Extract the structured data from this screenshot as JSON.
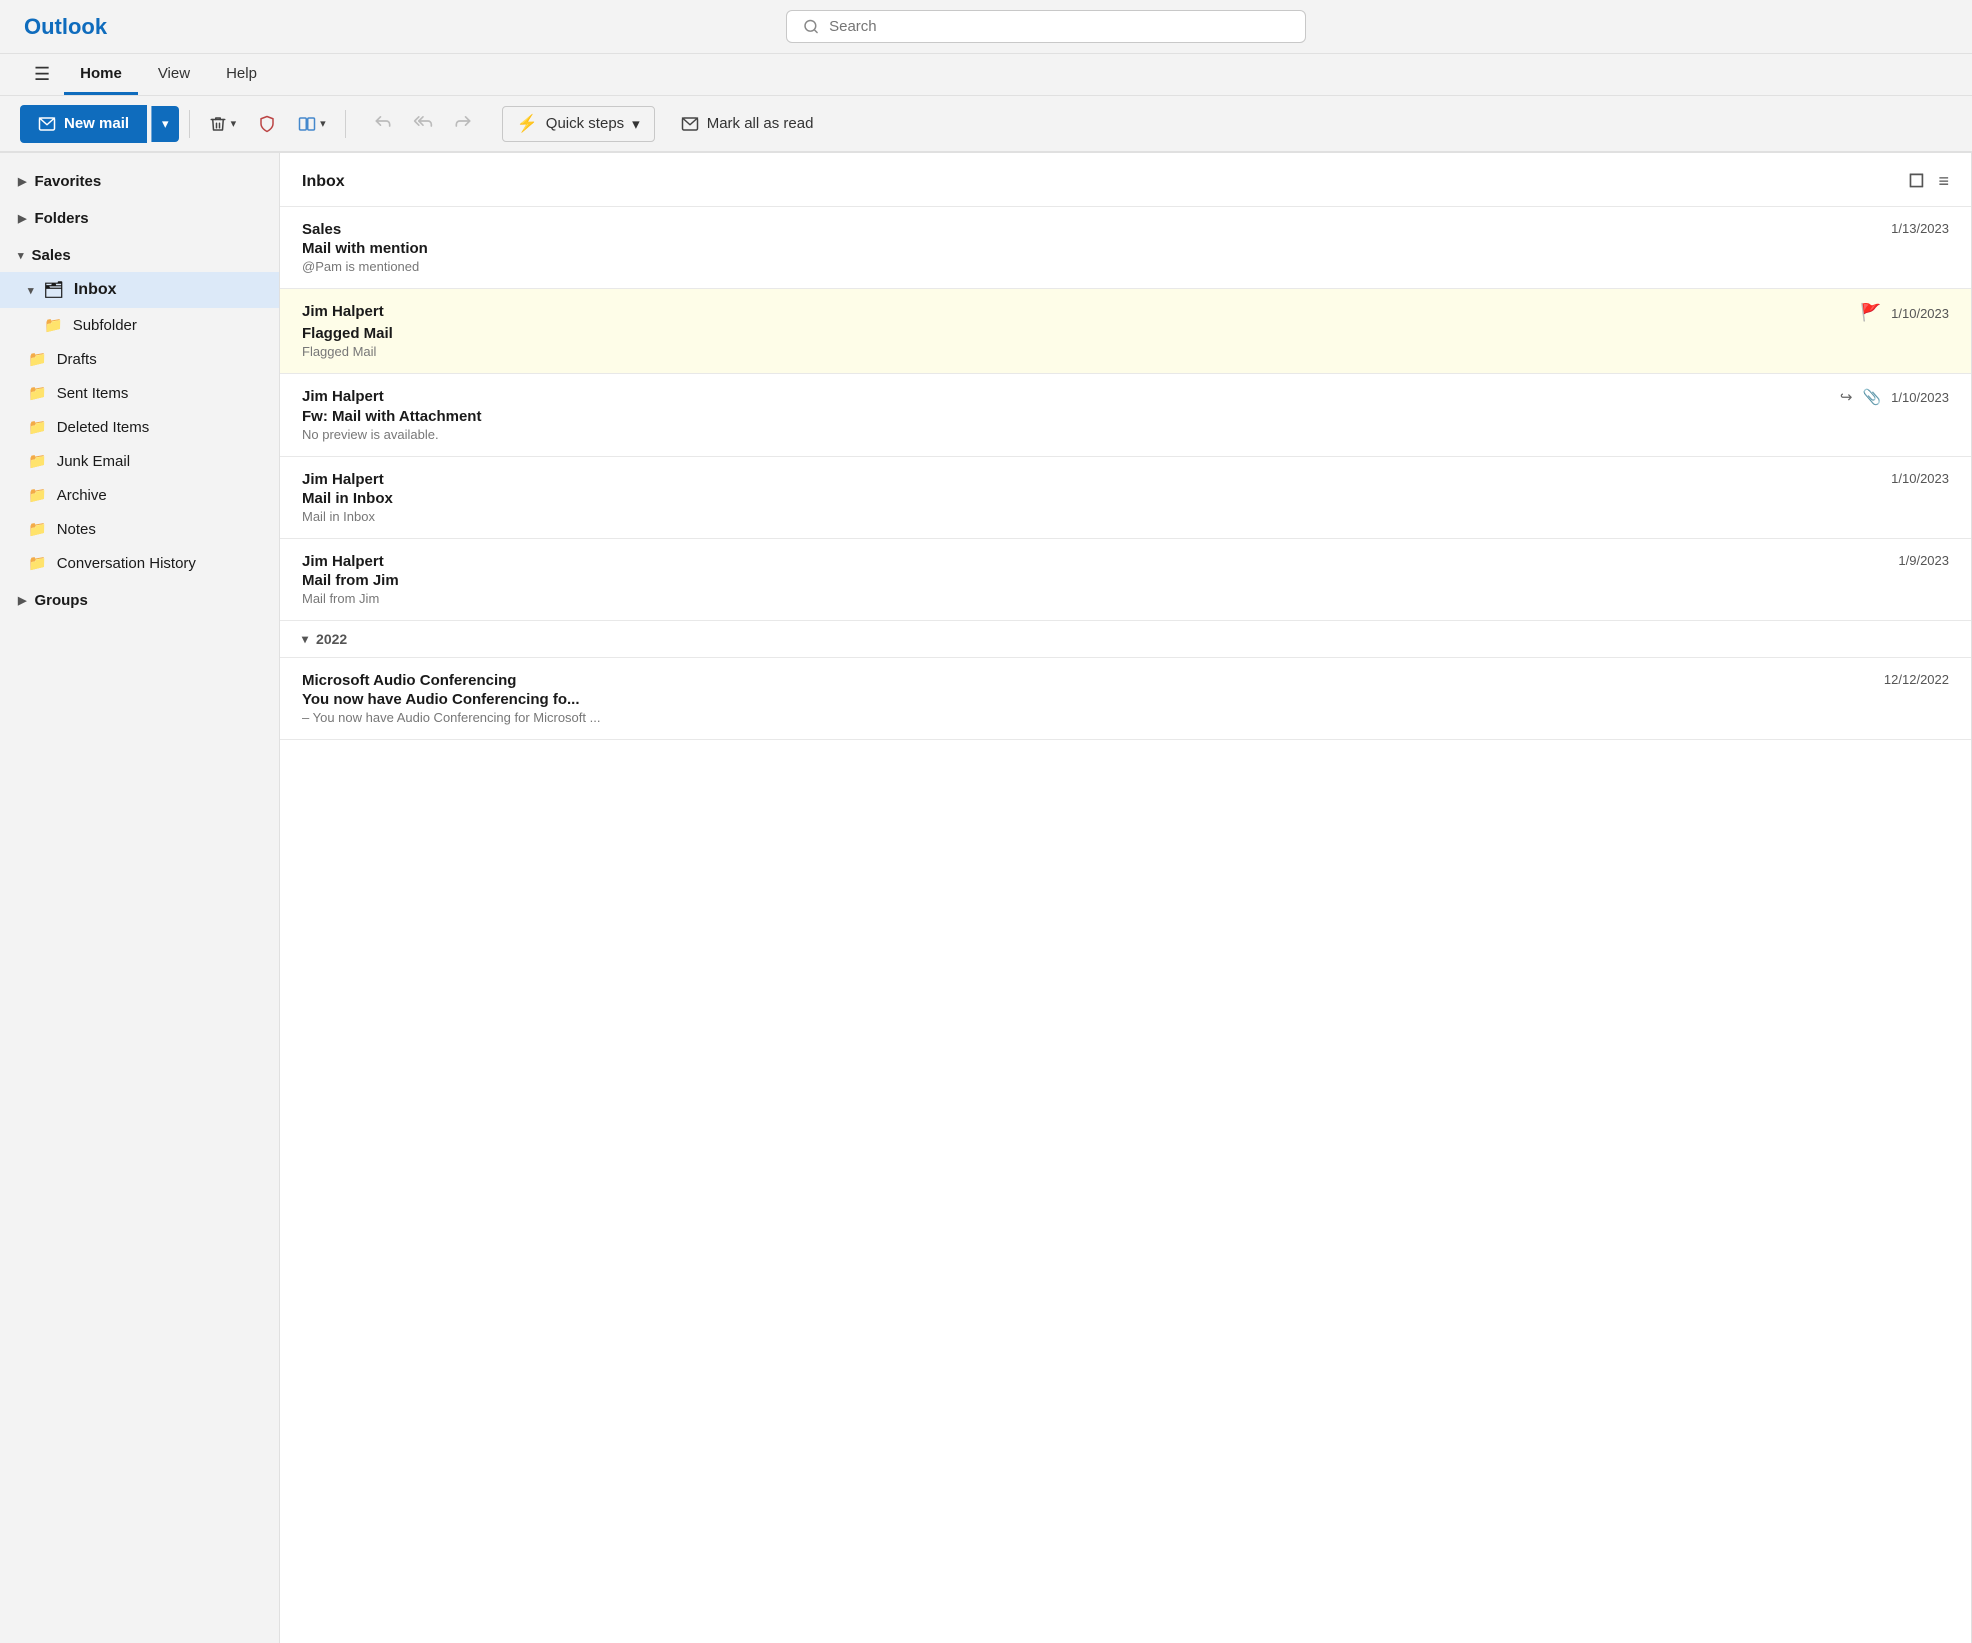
{
  "app": {
    "title": "Outlook"
  },
  "header": {
    "search_placeholder": "Search"
  },
  "nav": {
    "hamburger": "☰",
    "tabs": [
      {
        "label": "Home",
        "active": true
      },
      {
        "label": "View",
        "active": false
      },
      {
        "label": "Help",
        "active": false
      }
    ]
  },
  "toolbar": {
    "new_mail": "New mail",
    "new_mail_dropdown_arrow": "▾",
    "delete_icon": "🗑",
    "shield_icon": "🛡",
    "move_icon": "⤑",
    "reply_icon": "↩",
    "reply_all_icon": "↩↩",
    "forward_icon": "↪",
    "quick_steps_label": "Quick steps",
    "quick_steps_icon": "⚡",
    "quick_steps_arrow": "▾",
    "mark_all_read_label": "Mark all as read",
    "mark_all_read_icon": "✉"
  },
  "sidebar": {
    "favorites_label": "Favorites",
    "folders_label": "Folders",
    "sales_label": "Sales",
    "inbox_label": "Inbox",
    "subfolder_label": "Subfolder",
    "drafts_label": "Drafts",
    "sent_items_label": "Sent Items",
    "deleted_items_label": "Deleted Items",
    "junk_email_label": "Junk Email",
    "archive_label": "Archive",
    "notes_label": "Notes",
    "conversation_history_label": "Conversation History",
    "groups_label": "Groups"
  },
  "email_list": {
    "inbox_title": "Inbox",
    "emails": [
      {
        "sender": "Sales",
        "subject": "Mail with mention",
        "preview": "@Pam is mentioned",
        "date": "1/13/2023",
        "flagged": false,
        "forwarded": false,
        "has_attachment": false
      },
      {
        "sender": "Jim Halpert",
        "subject": "Flagged Mail",
        "preview": "Flagged Mail",
        "date": "1/10/2023",
        "flagged": true,
        "forwarded": false,
        "has_attachment": false
      },
      {
        "sender": "Jim Halpert",
        "subject": "Fw: Mail with Attachment",
        "preview": "No preview is available.",
        "date": "1/10/2023",
        "flagged": false,
        "forwarded": true,
        "has_attachment": true
      },
      {
        "sender": "Jim Halpert",
        "subject": "Mail in Inbox",
        "preview": "Mail in Inbox",
        "date": "1/10/2023",
        "flagged": false,
        "forwarded": false,
        "has_attachment": false
      },
      {
        "sender": "Jim Halpert",
        "subject": "Mail from Jim",
        "preview": "Mail from Jim",
        "date": "1/9/2023",
        "flagged": false,
        "forwarded": false,
        "has_attachment": false
      }
    ],
    "year_group": {
      "label": "2022",
      "collapsed": false
    },
    "year_emails": [
      {
        "sender": "Microsoft Audio Conferencing",
        "subject": "You now have Audio Conferencing fo...",
        "preview": "– You now have Audio Conferencing for Microsoft ...",
        "date": "12/12/2022",
        "flagged": false,
        "forwarded": false,
        "has_attachment": false
      }
    ]
  }
}
